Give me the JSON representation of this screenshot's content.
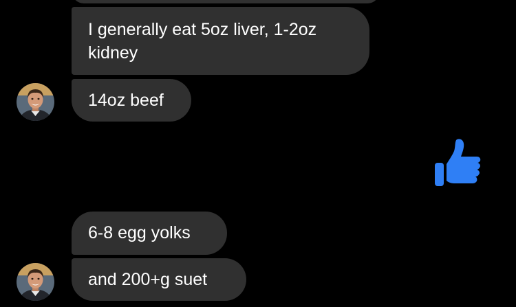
{
  "messages": [
    {
      "sender": "contact",
      "text_lines": [
        "I generally eat 5oz liver, 1-2oz",
        "kidney"
      ]
    },
    {
      "sender": "contact",
      "text": "14oz beef"
    },
    {
      "sender": "me",
      "type": "reaction",
      "icon": "thumbs-up-icon",
      "color": "#2f7ff5"
    },
    {
      "sender": "contact",
      "text": "6-8 egg yolks"
    },
    {
      "sender": "contact",
      "text": "and 200+g suet"
    }
  ],
  "theme": {
    "background": "#000000",
    "incoming_bubble": "#303030",
    "text": "#ffffff",
    "accent": "#2f7ff5"
  }
}
